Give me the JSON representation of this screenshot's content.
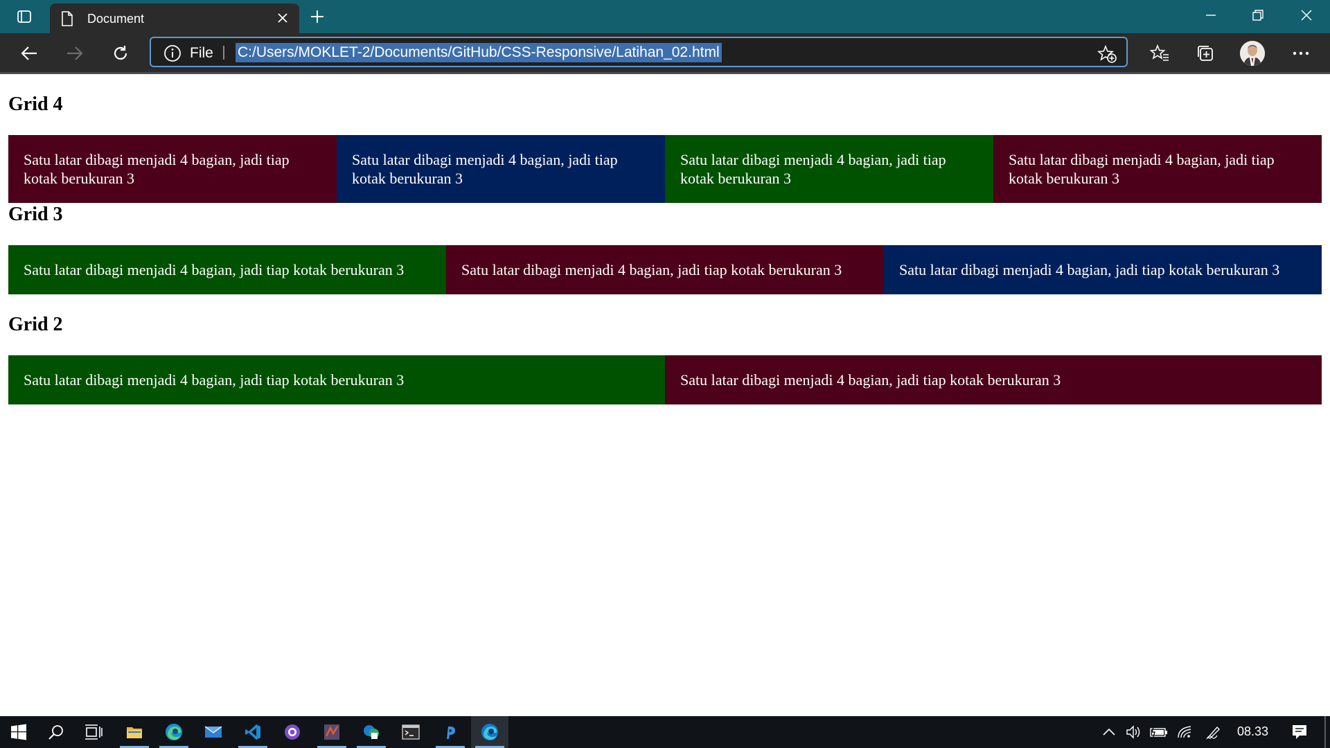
{
  "browser": {
    "tab_title": "Document",
    "address_scheme_label": "File",
    "url": "C:/Users/MOKLET-2/Documents/GitHub/CSS-Responsive/Latihan_02.html"
  },
  "page": {
    "sections": [
      {
        "heading": "Grid 4",
        "boxes": [
          {
            "text": "Satu latar dibagi menjadi 4 bagian, jadi tiap kotak berukuran 3",
            "color": "#4d0019"
          },
          {
            "text": "Satu latar dibagi menjadi 4 bagian, jadi tiap kotak berukuran 3",
            "color": "#00205b"
          },
          {
            "text": "Satu latar dibagi menjadi 4 bagian, jadi tiap kotak berukuran 3",
            "color": "#005100"
          },
          {
            "text": "Satu latar dibagi menjadi 4 bagian, jadi tiap kotak berukuran 3",
            "color": "#4d0019"
          }
        ]
      },
      {
        "heading": "Grid 3",
        "boxes": [
          {
            "text": "Satu latar dibagi menjadi 4 bagian, jadi tiap kotak berukuran 3",
            "color": "#005100"
          },
          {
            "text": "Satu latar dibagi menjadi 4 bagian, jadi tiap kotak berukuran 3",
            "color": "#4d0019"
          },
          {
            "text": "Satu latar dibagi menjadi 4 bagian, jadi tiap kotak berukuran 3",
            "color": "#00205b"
          }
        ]
      },
      {
        "heading": "Grid 2",
        "boxes": [
          {
            "text": "Satu latar dibagi menjadi 4 bagian, jadi tiap kotak berukuran 3",
            "color": "#005100"
          },
          {
            "text": "Satu latar dibagi menjadi 4 bagian, jadi tiap kotak berukuran 3",
            "color": "#4d0019"
          }
        ]
      }
    ]
  },
  "taskbar": {
    "clock": "08.33",
    "apps": [
      "file-explorer-icon",
      "edge-icon",
      "mail-icon",
      "vscode-icon",
      "github-desktop-icon",
      "app-icon",
      "store-icon",
      "terminal-icon",
      "php-storm-icon",
      "edge-dev-icon"
    ]
  },
  "colors": {
    "titlebar": "#135f6e",
    "toolbar": "#2b2b2b",
    "url_highlight": "#3d6fae",
    "maroon": "#4d0019",
    "navy": "#00205b",
    "green": "#005100"
  }
}
